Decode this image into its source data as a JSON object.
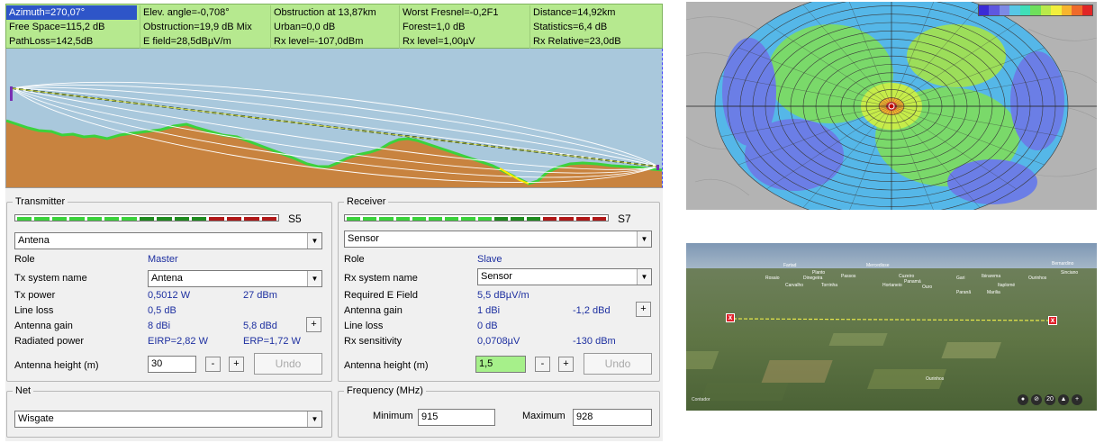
{
  "info_bar": {
    "rows": [
      [
        "Azimuth=270,07°",
        "Elev. angle=-0,708°",
        "Obstruction at 13,87km",
        "Worst Fresnel=-0,2F1",
        "Distance=14,92km"
      ],
      [
        "Free Space=115,2 dB",
        "Obstruction=19,9 dB Mix",
        "Urban=0,0 dB",
        "Forest=1,0 dB",
        "Statistics=6,4 dB"
      ],
      [
        "PathLoss=142,5dB",
        "E field=28,5dBµV/m",
        "Rx level=-107,0dBm",
        "Rx level=1,00µV",
        "Rx Relative=23,0dB"
      ]
    ]
  },
  "transmitter": {
    "group_label": "Transmitter",
    "signal_label": "S5",
    "signal_segments": [
      "#3bd13b",
      "#3bd13b",
      "#3bd13b",
      "#3bd13b",
      "#3bd13b",
      "#3bd13b",
      "#3bd13b",
      "#1f8a1f",
      "#1f8a1f",
      "#1f8a1f",
      "#1f8a1f",
      "#b01818",
      "#b01818",
      "#b01818",
      "#b01818"
    ],
    "station": "Antena",
    "role_label": "Role",
    "role_value": "Master",
    "system_label": "Tx system name",
    "system_value": "Antena",
    "power_label": "Tx power",
    "power_w": "0,5012 W",
    "power_dbm": "27 dBm",
    "loss_label": "Line loss",
    "loss_value": "0,5 dB",
    "gain_label": "Antenna gain",
    "gain_dbi": "8 dBi",
    "gain_dbd": "5,8 dBd",
    "radiated_label": "Radiated power",
    "eirp": "EIRP=2,82 W",
    "erp": "ERP=1,72 W",
    "height_label": "Antenna height (m)",
    "height_value": "30",
    "undo_label": "Undo"
  },
  "receiver": {
    "group_label": "Receiver",
    "signal_label": "S7",
    "signal_segments": [
      "#3bd13b",
      "#3bd13b",
      "#3bd13b",
      "#3bd13b",
      "#3bd13b",
      "#3bd13b",
      "#3bd13b",
      "#3bd13b",
      "#3bd13b",
      "#1f8a1f",
      "#1f8a1f",
      "#1f8a1f",
      "#b01818",
      "#b01818",
      "#b01818",
      "#b01818"
    ],
    "station": "Sensor",
    "role_label": "Role",
    "role_value": "Slave",
    "system_label": "Rx system name",
    "system_value": "Sensor",
    "efield_label": "Required E Field",
    "efield_value": "5,5 dBµV/m",
    "gain_label": "Antenna gain",
    "gain_dbi": "1 dBi",
    "gain_dbd": "-1,2 dBd",
    "loss_label": "Line loss",
    "loss_value": "0 dB",
    "sens_label": "Rx sensitivity",
    "sens_uv": "0,0708µV",
    "sens_dbm": "-130 dBm",
    "height_label": "Antenna height (m)",
    "height_value": "1,5",
    "undo_label": "Undo"
  },
  "net": {
    "group_label": "Net",
    "value": "Wisgate"
  },
  "frequency": {
    "group_label": "Frequency (MHz)",
    "min_label": "Minimum",
    "min_value": "915",
    "max_label": "Maximum",
    "max_value": "928"
  },
  "buttons": {
    "minus": "-",
    "plus": "+"
  },
  "coverage_legend": [
    "#3a2bd6",
    "#5e57e0",
    "#7c8ae6",
    "#57c7e6",
    "#3fdfb8",
    "#6ee05c",
    "#b9ea4a",
    "#f2ef3c",
    "#f7b52e",
    "#ef6a2a",
    "#e02626"
  ],
  "terrain": {
    "cities": [
      "Fartad",
      "Mercedisse",
      "Planto",
      "Rosaio",
      "Dinegeira",
      "Passos",
      "Cuzeiro",
      "Panamá",
      "Carvalho",
      "Torrinha",
      "Hortaneio",
      "Ouro",
      "Gari",
      "Ibirarema",
      "Itaplomé",
      "Ourinhos",
      "Bernardino",
      "Paranã",
      "Marilia",
      "Sinciano",
      "Ourinhos"
    ],
    "footnote": "Contador",
    "zoom_label": "20"
  },
  "colors": {
    "info_bg": "#b6e98f",
    "sky": "#a9c8dc",
    "terrain": "#c8833f",
    "terrain_edge": "#3cd23c",
    "value_text": "#1d2fa0"
  }
}
